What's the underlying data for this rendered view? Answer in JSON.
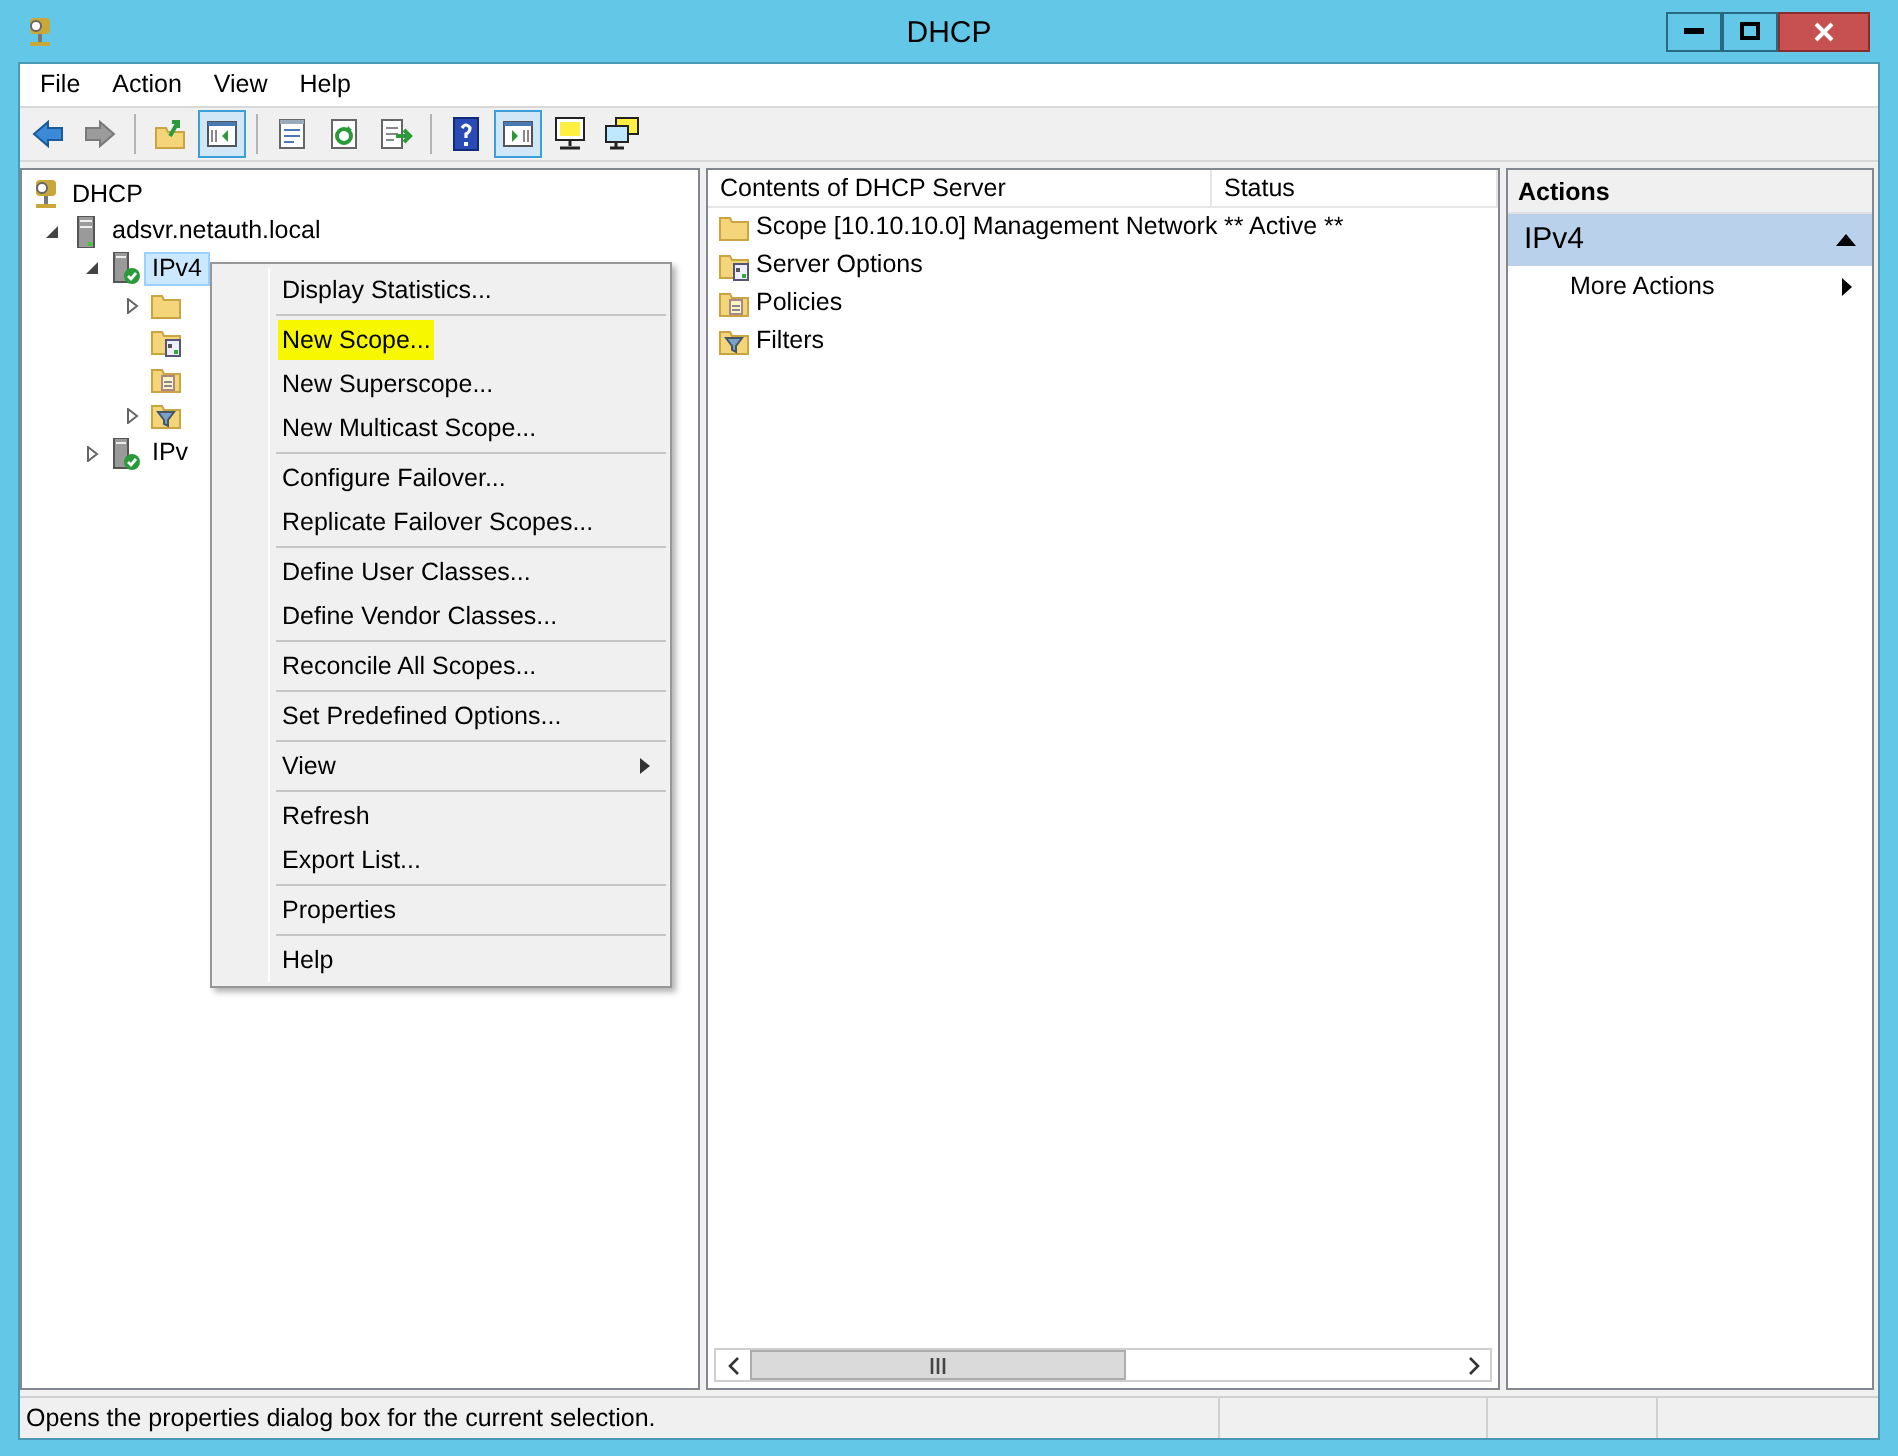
{
  "window": {
    "title": "DHCP"
  },
  "menu_bar": [
    "File",
    "Action",
    "View",
    "Help"
  ],
  "toolbar": [
    {
      "kind": "back",
      "disabled": false,
      "pressed": false
    },
    {
      "kind": "forward",
      "disabled": true,
      "pressed": false
    },
    {
      "kind": "separator"
    },
    {
      "kind": "up",
      "disabled": false,
      "pressed": false
    },
    {
      "kind": "console-tree",
      "disabled": false,
      "pressed": true
    },
    {
      "kind": "separator"
    },
    {
      "kind": "properties",
      "disabled": false,
      "pressed": false
    },
    {
      "kind": "refresh",
      "disabled": false,
      "pressed": false
    },
    {
      "kind": "export",
      "disabled": false,
      "pressed": false
    },
    {
      "kind": "separator"
    },
    {
      "kind": "help",
      "disabled": false,
      "pressed": false
    },
    {
      "kind": "action-pane",
      "disabled": false,
      "pressed": true
    },
    {
      "kind": "monitor",
      "disabled": false,
      "pressed": false
    },
    {
      "kind": "monitors",
      "disabled": false,
      "pressed": false
    }
  ],
  "tree": [
    {
      "label": "DHCP",
      "kind": "root",
      "selected": false,
      "children": [
        {
          "label": "adsvr.netauth.local",
          "kind": "server",
          "selected": false,
          "expanded": true,
          "children": [
            {
              "label": "IPv4",
              "kind": "protocol",
              "selected": true,
              "expanded": true,
              "children": [
                {
                  "kind": "folder",
                  "expanded": false
                },
                {
                  "kind": "options"
                },
                {
                  "kind": "policies"
                },
                {
                  "kind": "filters",
                  "expanded": false
                }
              ]
            },
            {
              "label": "IPv",
              "kind": "protocol",
              "selected": false,
              "expanded": false
            }
          ]
        }
      ]
    }
  ],
  "context_menu": [
    [
      {
        "label": "Display Statistics...",
        "highlighted": false,
        "submenu": false
      }
    ],
    [
      {
        "label": "New Scope...",
        "highlighted": true,
        "submenu": false
      },
      {
        "label": "New Superscope...",
        "highlighted": false,
        "submenu": false
      },
      {
        "label": "New Multicast Scope...",
        "highlighted": false,
        "submenu": false
      }
    ],
    [
      {
        "label": "Configure Failover...",
        "highlighted": false,
        "submenu": false
      },
      {
        "label": "Replicate Failover Scopes...",
        "highlighted": false,
        "submenu": false
      }
    ],
    [
      {
        "label": "Define User Classes...",
        "highlighted": false,
        "submenu": false
      },
      {
        "label": "Define Vendor Classes...",
        "highlighted": false,
        "submenu": false
      }
    ],
    [
      {
        "label": "Reconcile All Scopes...",
        "highlighted": false,
        "submenu": false
      }
    ],
    [
      {
        "label": "Set Predefined Options...",
        "highlighted": false,
        "submenu": false
      }
    ],
    [
      {
        "label": "View",
        "highlighted": false,
        "submenu": true
      }
    ],
    [
      {
        "label": "Refresh",
        "highlighted": false,
        "submenu": false
      },
      {
        "label": "Export List...",
        "highlighted": false,
        "submenu": false
      }
    ],
    [
      {
        "label": "Properties",
        "highlighted": false,
        "submenu": false
      }
    ],
    [
      {
        "label": "Help",
        "highlighted": false,
        "submenu": false
      }
    ]
  ],
  "list": {
    "columns": [
      "Contents of DHCP Server",
      "Status"
    ],
    "rows": [
      {
        "kind": "folder",
        "name": "Scope [10.10.10.0] Management Network",
        "status": "** Active **"
      },
      {
        "kind": "options",
        "name": "Server Options"
      },
      {
        "kind": "policies",
        "name": "Policies"
      },
      {
        "kind": "filters",
        "name": "Filters"
      }
    ]
  },
  "actions": {
    "title": "Actions",
    "sections": [
      {
        "title": "IPv4",
        "expanded": true,
        "items": [
          {
            "label": "More Actions",
            "submenu": true
          }
        ]
      }
    ]
  },
  "status_bar": "Opens the properties dialog box for the current selection."
}
